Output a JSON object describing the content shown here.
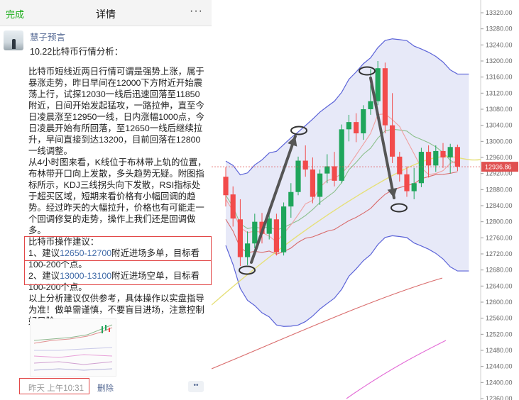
{
  "nav": {
    "done": "完成",
    "title": "详情",
    "more": "···"
  },
  "post": {
    "author": "慧子预言",
    "subtitle": "10.22比特币行情分析：",
    "para1": "比特币短线近两日行情可谓是强势上涨，属于暴涨走势，昨日早间在12000下方附近开始震荡上行，试探12030一线后迅速回落至11850附近，日间开始发起猛攻，一路拉伸，直至今日凌晨涨至12950一线，日内涨幅1000点，今日凌晨开始有所回落，至12650一线后继续拉升，早间直接到达13200，目前回落在12800一线调整。",
    "para2": "从4小时图来看，K线位于布林带上轨的位置，布林带开口向上发散，多头趋势无疑。附图指标所示，KDJ三线拐头向下发散，RSI指标处于超买区域，短期来看价格有小幅回调的趋势。经过昨天的大幅拉升，价格也有可能走一个回调修复的走势，操作上我们还是回调做多。",
    "ops_title": "比特币操作建议：",
    "op1_pre": "1、建议",
    "op1_range": "12650-12700",
    "op1_post": "附近进场多单，目标看100-200个点。",
    "op2_pre": "2、建议",
    "op2_range": "13000-13100",
    "op2_post": "附近进场空单，目标看100-200个点。",
    "para3": "以上分析建议仅供参考，具体操作以实盘指导为准！做单需谨慎，不要盲目进场，注意控制好风险。",
    "time": "昨天 上午10:31",
    "delete": "删除",
    "dots": "••"
  },
  "chart_data": {
    "type": "candlestick",
    "y_ticks": [
      "13320.00",
      "13280.00",
      "13240.00",
      "13200.00",
      "13160.00",
      "13120.00",
      "13080.00",
      "13040.00",
      "13000.00",
      "12960.00",
      "12920.00",
      "12880.00",
      "12840.00",
      "12800.00",
      "12760.00",
      "12720.00",
      "12680.00",
      "12640.00",
      "12600.00",
      "12560.00",
      "12520.00",
      "12480.00",
      "12440.00",
      "12400.00",
      "12360.00"
    ],
    "ylim": [
      12360,
      13340
    ],
    "current_price": "12936.86",
    "colors": {
      "up": "#1fa55b",
      "down": "#f24b4b",
      "band": "#c9cfef",
      "band_line": "#5b63d8",
      "ma_yellow": "#e6e07a",
      "ma_red": "#d96b6b",
      "ma_green": "#8cc08c",
      "ma_pink": "#e36bd6",
      "ma_salmon": "#f0a0a0",
      "arrow": "#555555",
      "price_line": "#e05050"
    },
    "candles": [
      {
        "o": 12912,
        "h": 12936,
        "l": 12838,
        "c": 12866
      },
      {
        "o": 12868,
        "h": 12888,
        "l": 12788,
        "c": 12808
      },
      {
        "o": 12806,
        "h": 12856,
        "l": 12690,
        "c": 12712
      },
      {
        "o": 12712,
        "h": 12776,
        "l": 12692,
        "c": 12746
      },
      {
        "o": 12746,
        "h": 12820,
        "l": 12734,
        "c": 12800
      },
      {
        "o": 12800,
        "h": 12822,
        "l": 12746,
        "c": 12770
      },
      {
        "o": 12770,
        "h": 12826,
        "l": 12756,
        "c": 12808
      },
      {
        "o": 12806,
        "h": 12820,
        "l": 12716,
        "c": 12724
      },
      {
        "o": 12724,
        "h": 12848,
        "l": 12716,
        "c": 12838
      },
      {
        "o": 12838,
        "h": 12896,
        "l": 12810,
        "c": 12874
      },
      {
        "o": 12874,
        "h": 12962,
        "l": 12866,
        "c": 12952
      },
      {
        "o": 12952,
        "h": 12990,
        "l": 12912,
        "c": 12930
      },
      {
        "o": 12930,
        "h": 12960,
        "l": 12846,
        "c": 12862
      },
      {
        "o": 12862,
        "h": 12930,
        "l": 12842,
        "c": 12920
      },
      {
        "o": 12920,
        "h": 12968,
        "l": 12896,
        "c": 12938
      },
      {
        "o": 12938,
        "h": 12974,
        "l": 12888,
        "c": 12902
      },
      {
        "o": 12902,
        "h": 13042,
        "l": 12896,
        "c": 13030
      },
      {
        "o": 13030,
        "h": 13066,
        "l": 13000,
        "c": 13048
      },
      {
        "o": 13048,
        "h": 13070,
        "l": 12998,
        "c": 13020
      },
      {
        "o": 13020,
        "h": 13090,
        "l": 13004,
        "c": 13080
      },
      {
        "o": 13080,
        "h": 13180,
        "l": 13066,
        "c": 13100
      },
      {
        "o": 13100,
        "h": 13200,
        "l": 13090,
        "c": 13182
      },
      {
        "o": 13182,
        "h": 13196,
        "l": 13020,
        "c": 13040
      },
      {
        "o": 13040,
        "h": 13120,
        "l": 12946,
        "c": 12962
      },
      {
        "o": 12962,
        "h": 12974,
        "l": 12900,
        "c": 12918
      },
      {
        "o": 12918,
        "h": 12938,
        "l": 12862,
        "c": 12876
      },
      {
        "o": 12876,
        "h": 12934,
        "l": 12856,
        "c": 12896
      },
      {
        "o": 12896,
        "h": 12984,
        "l": 12886,
        "c": 12974
      },
      {
        "o": 12974,
        "h": 12990,
        "l": 12910,
        "c": 12940
      },
      {
        "o": 12940,
        "h": 12990,
        "l": 12924,
        "c": 12976
      },
      {
        "o": 12976,
        "h": 12996,
        "l": 12934,
        "c": 12960
      },
      {
        "o": 12960,
        "h": 12994,
        "l": 12920,
        "c": 12986
      },
      {
        "o": 12986,
        "h": 12992,
        "l": 12926,
        "c": 12937
      }
    ]
  }
}
